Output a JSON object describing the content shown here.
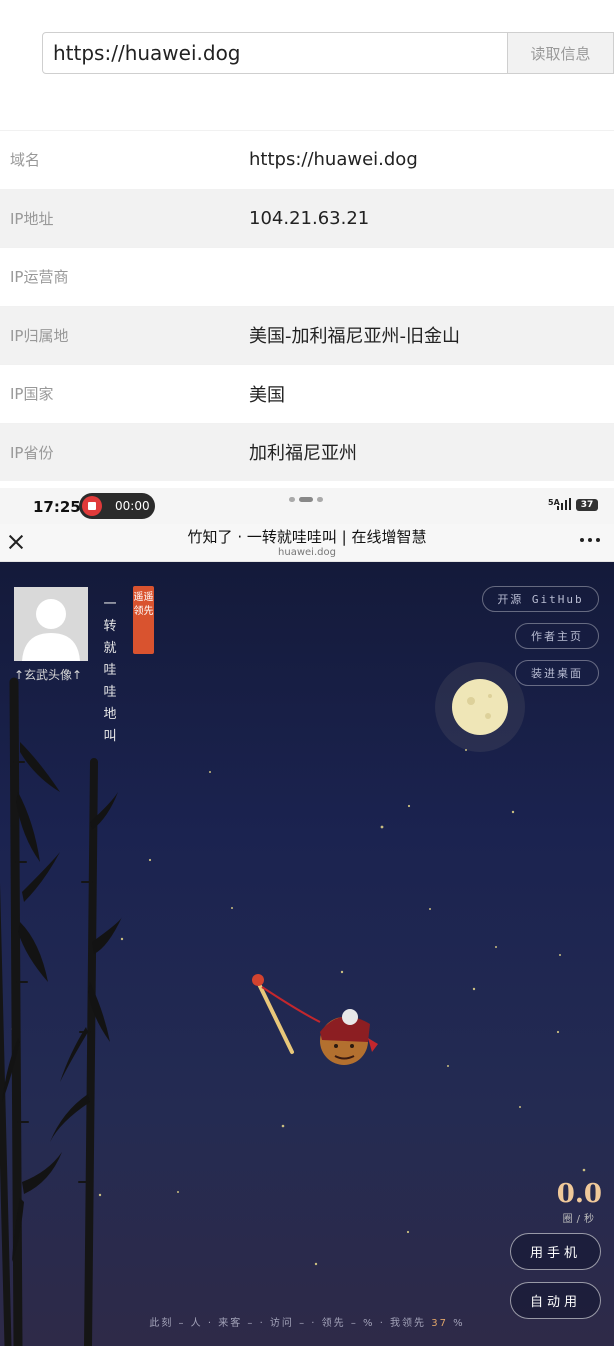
{
  "lookup": {
    "url_value": "https://huawei.dog",
    "read_button": "读取信息",
    "rows": [
      {
        "key": "域名",
        "value": "https://huawei.dog"
      },
      {
        "key": "IP地址",
        "value": "104.21.63.21"
      },
      {
        "key": "IP运营商",
        "value": ""
      },
      {
        "key": "IP归属地",
        "value": "美国-加利福尼亚州-旧金山"
      },
      {
        "key": "IP国家",
        "value": "美国"
      },
      {
        "key": "IP省份",
        "value": "加利福尼亚州"
      }
    ]
  },
  "status_bar": {
    "time": "17:25",
    "recording_time": "00:00",
    "network": "5A",
    "battery": "37"
  },
  "webview": {
    "title": "竹知了 · 一转就哇哇叫 | 在线增智慧",
    "domain": "huawei.dog"
  },
  "game": {
    "avatar_caption": "↑玄武头像↑",
    "vertical_slogan": "一转就哇哇地叫",
    "badge": "遥遥领先",
    "links": {
      "github": "开源 GitHub",
      "author": "作者主页",
      "install": "装进桌面"
    },
    "speed_value": "0.0",
    "speed_unit": "圈/秒",
    "buttons": {
      "manual": "用手机",
      "auto": "自动用"
    },
    "footer": {
      "text": "此刻 – 人 · 来客 – · 访问 – · 领先 – % · 我领先 ",
      "lead_value": "37",
      "lead_unit": " %"
    }
  },
  "colors": {
    "badge": "#d9532f",
    "speed": "#f0c99a",
    "sky_top": "#141a3a",
    "sky_bottom": "#2e2a48"
  },
  "icons": [
    "close-icon",
    "more-icon",
    "record-icon",
    "signal-icon",
    "battery-icon",
    "moon-icon",
    "avatar-placeholder-icon"
  ]
}
